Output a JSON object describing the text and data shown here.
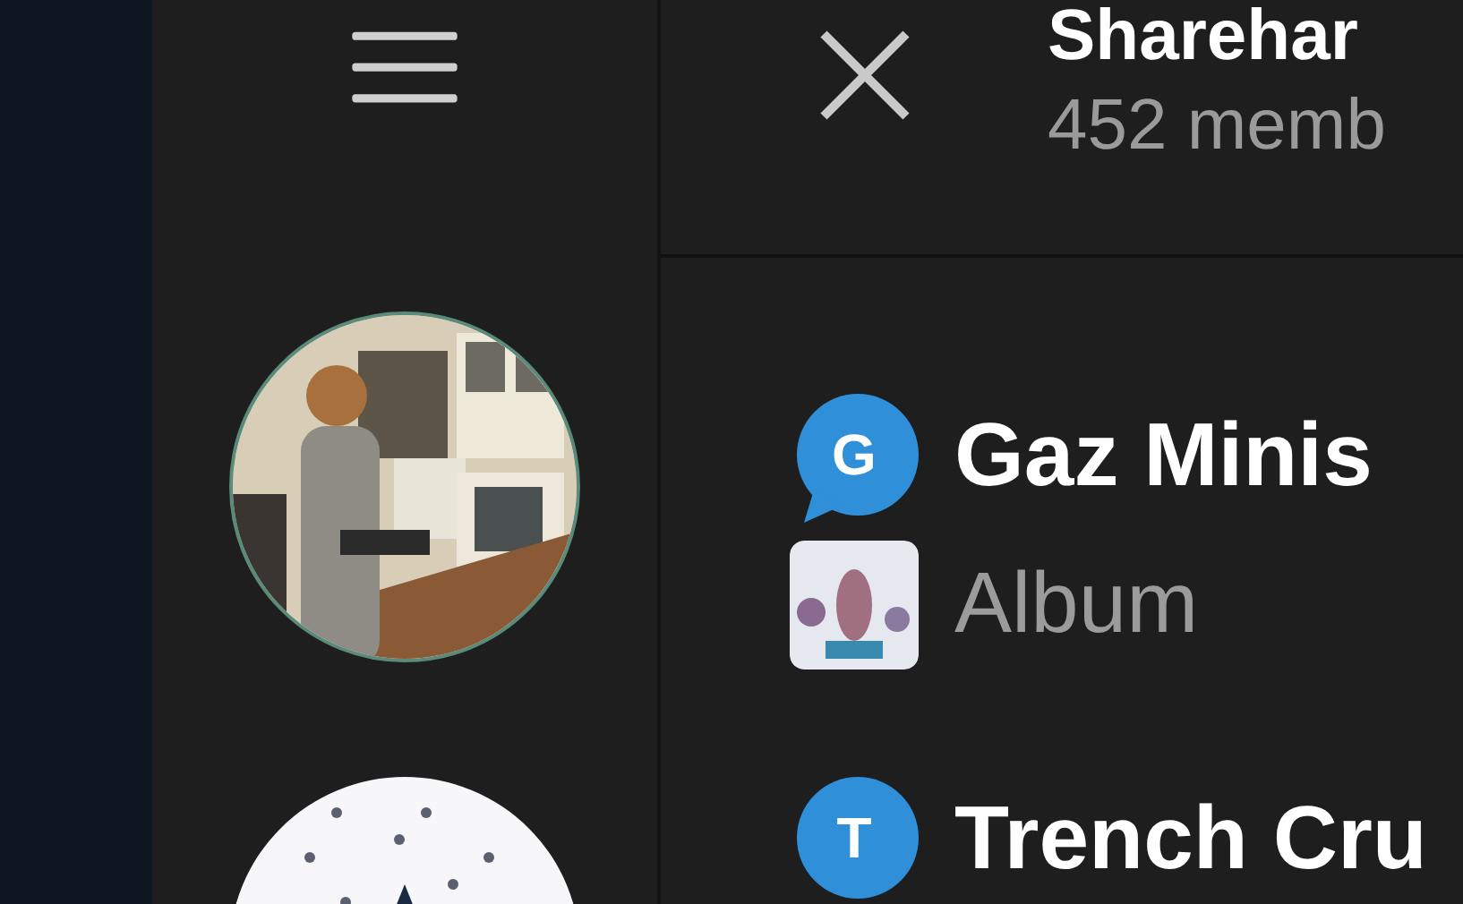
{
  "header": {
    "title": "Sharehar",
    "subtitle": "452 memb"
  },
  "sidebar": {
    "items": [
      {
        "kind": "picture"
      },
      {
        "kind": "emblem"
      }
    ]
  },
  "chats": [
    {
      "kind": "bubble",
      "initial": "G",
      "name": "Gaz Minis",
      "preview": "Album"
    },
    {
      "kind": "circle",
      "initial": "T",
      "name": "Trench Cru"
    }
  ]
}
